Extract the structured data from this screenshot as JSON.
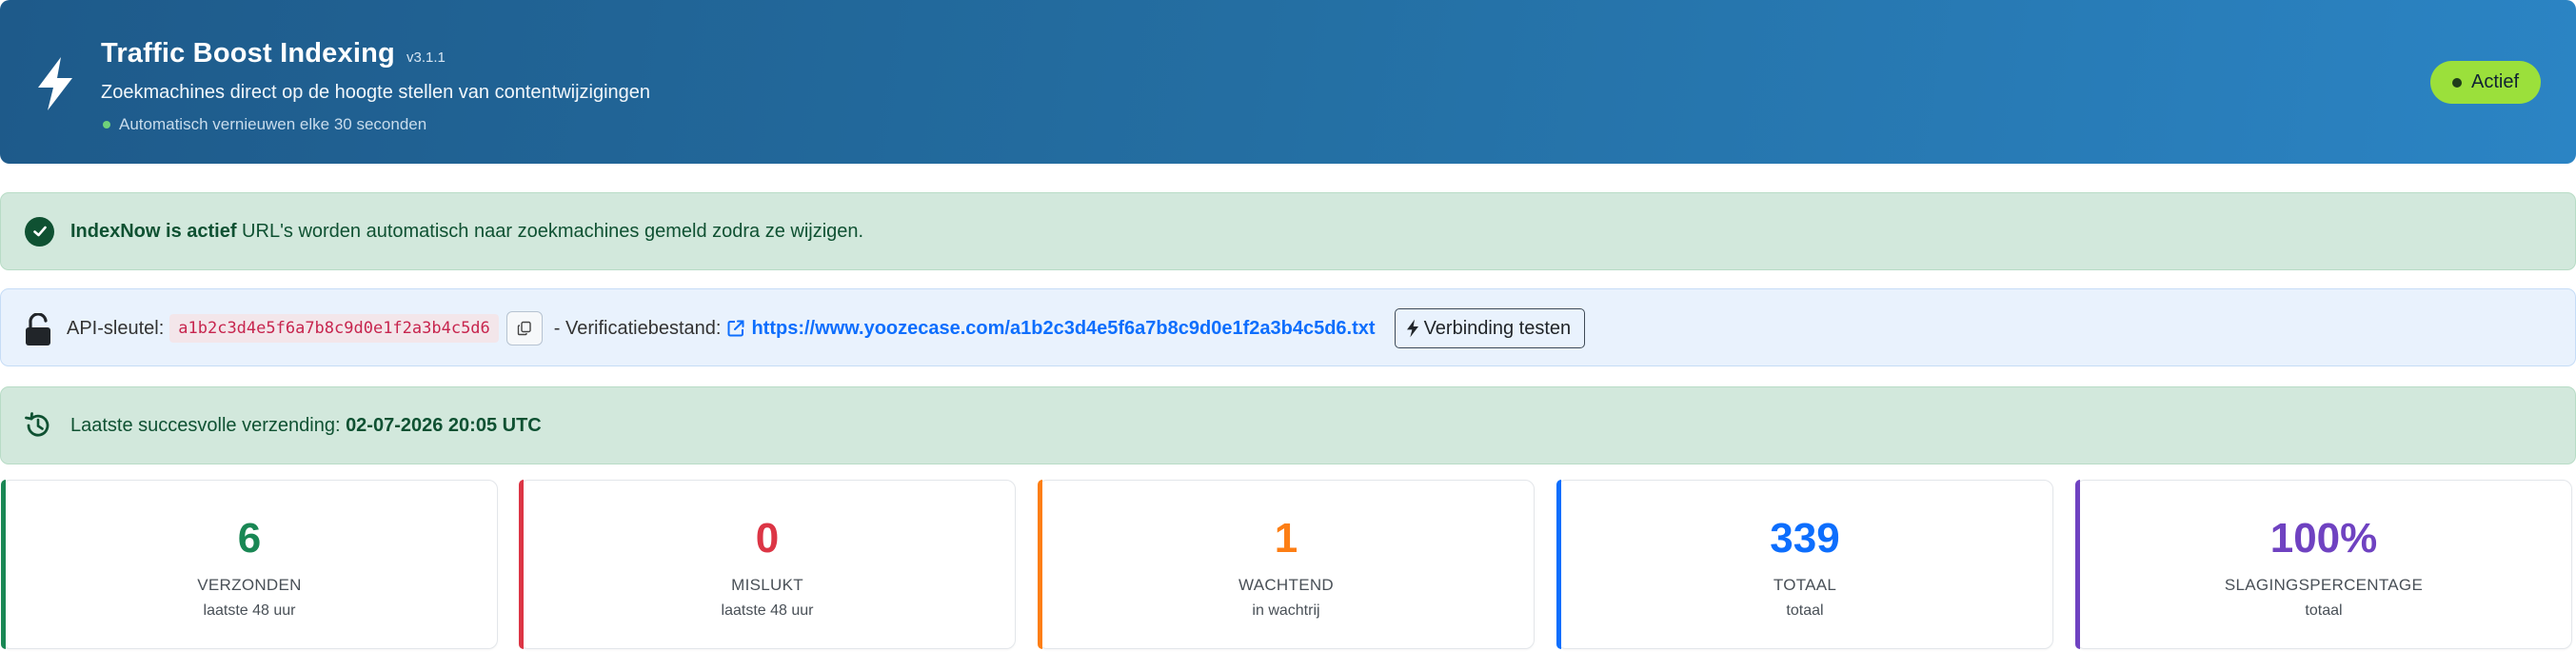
{
  "header": {
    "title": "Traffic Boost Indexing",
    "version": "v3.1.1",
    "subtitle": "Zoekmachines direct op de hoogte stellen van contentwijzigingen",
    "refresh_text": "Automatisch vernieuwen elke 30 seconden",
    "icon": "bolt-icon",
    "status_label": "Actief",
    "status_color": "#9be03b"
  },
  "status_alert": {
    "bold": "IndexNow is actief",
    "text": " URL's worden automatisch naar zoekmachines gemeld zodra ze wijzigen.",
    "icon": "check-circle-icon"
  },
  "api": {
    "label": "API-sleutel:",
    "key": "a1b2c3d4e5f6a7b8c9d0e1f2a3b4c5d6",
    "verification_label": "- Verificatiebestand:",
    "verification_url": "https://www.yoozecase.com/a1b2c3d4e5f6a7b8c9d0e1f2a3b4c5d6.txt",
    "test_button": "Verbinding testen",
    "icons": [
      "lock-open-icon",
      "copy-icon",
      "external-link-icon",
      "bolt-icon"
    ]
  },
  "last_submission": {
    "label": "Laatste succesvolle verzending: ",
    "value": "02-07-2026 20:05 UTC",
    "icon": "history-icon"
  },
  "stats": [
    {
      "value": "6",
      "label": "VERZONDEN",
      "sub": "laatste 48 uur",
      "color": "#198754"
    },
    {
      "value": "0",
      "label": "MISLUKT",
      "sub": "laatste 48 uur",
      "color": "#dc3545"
    },
    {
      "value": "1",
      "label": "WACHTEND",
      "sub": "in wachtrij",
      "color": "#fd7e14"
    },
    {
      "value": "339",
      "label": "TOTAAL",
      "sub": "totaal",
      "color": "#0d6efd"
    },
    {
      "value": "100%",
      "label": "SLAGINGSPERCENTAGE",
      "sub": "totaal",
      "color": "#6f42c1"
    }
  ]
}
